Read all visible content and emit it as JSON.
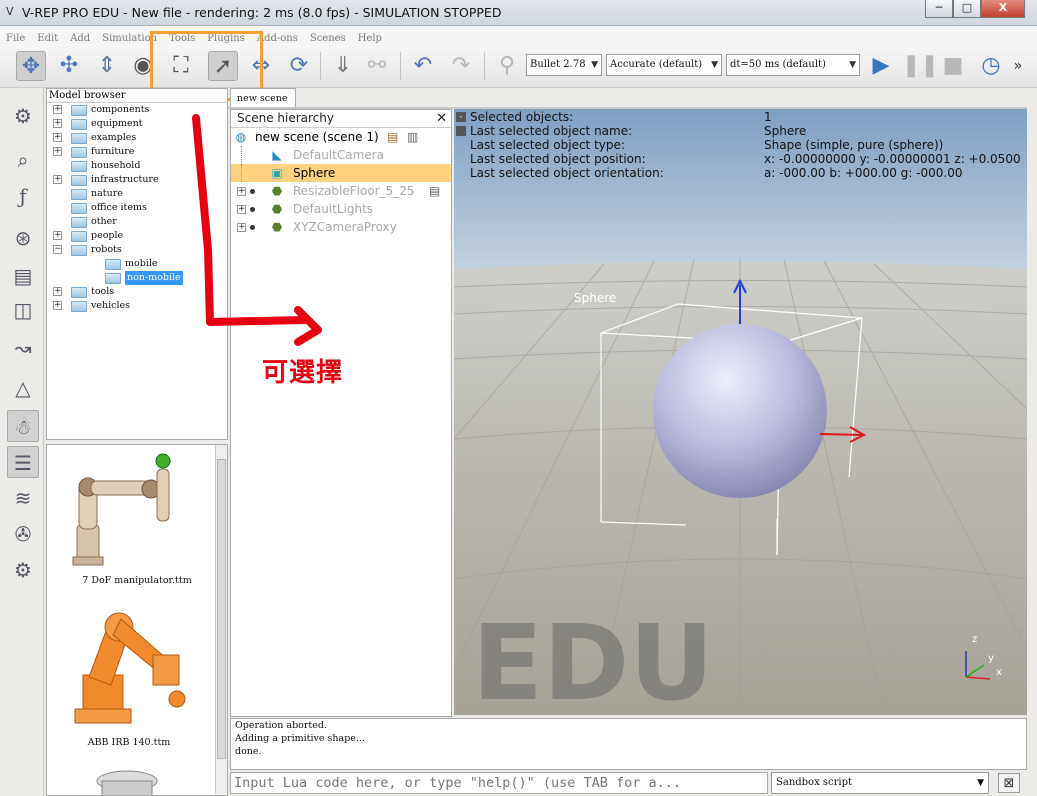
{
  "window": {
    "title": "V-REP PRO EDU - New file - rendering: 2 ms (8.0 fps) - SIMULATION STOPPED",
    "min_glyph": "─",
    "max_glyph": "□",
    "close_glyph": "X"
  },
  "menu": [
    "File",
    "Edit",
    "Add",
    "Simulation",
    "Tools",
    "Plugins",
    "Add-ons",
    "Scenes",
    "Help"
  ],
  "toolbar": {
    "physics_engine": "Bullet 2.78",
    "accuracy": "Accurate (default)",
    "timestep": "dt=50 ms (default)",
    "more_glyph": "»"
  },
  "model_browser": {
    "header": "Model browser",
    "items": [
      {
        "label": "components",
        "expander": "+",
        "indent": 0
      },
      {
        "label": "equipment",
        "expander": "+",
        "indent": 0
      },
      {
        "label": "examples",
        "expander": "+",
        "indent": 0
      },
      {
        "label": "furniture",
        "expander": "+",
        "indent": 0
      },
      {
        "label": "household",
        "expander": "",
        "indent": 0
      },
      {
        "label": "infrastructure",
        "expander": "+",
        "indent": 0
      },
      {
        "label": "nature",
        "expander": "",
        "indent": 0
      },
      {
        "label": "office items",
        "expander": "",
        "indent": 0
      },
      {
        "label": "other",
        "expander": "",
        "indent": 0
      },
      {
        "label": "people",
        "expander": "+",
        "indent": 0
      },
      {
        "label": "robots",
        "expander": "−",
        "indent": 0
      },
      {
        "label": "mobile",
        "expander": "",
        "indent": 1
      },
      {
        "label": "non-mobile",
        "expander": "",
        "indent": 1,
        "selected": true
      },
      {
        "label": "tools",
        "expander": "+",
        "indent": 0
      },
      {
        "label": "vehicles",
        "expander": "+",
        "indent": 0
      }
    ],
    "thumbnails": [
      "7 DoF manipulator.ttm",
      "ABB IRB 140.ttm"
    ]
  },
  "scene_tab": "new scene",
  "hierarchy": {
    "header": "Scene hierarchy",
    "close_glyph": "✕",
    "root": "new scene (scene 1)",
    "items": [
      {
        "name": "DefaultCamera",
        "icon": "camera-icon",
        "dim": true,
        "expander": false
      },
      {
        "name": "Sphere",
        "icon": "shape-icon",
        "dim": false,
        "selected": true,
        "expander": false
      },
      {
        "name": "ResizableFloor_5_25",
        "icon": "dummy-icon",
        "dim": true,
        "expander": true
      },
      {
        "name": "DefaultLights",
        "icon": "dummy-icon",
        "dim": true,
        "expander": true
      },
      {
        "name": "XYZCameraProxy",
        "icon": "dummy-icon",
        "dim": true,
        "expander": true
      }
    ]
  },
  "info": {
    "labels": [
      "Selected objects:",
      "Last selected object name:",
      "Last selected object type:",
      "Last selected object position:",
      "Last selected object orientation:"
    ],
    "values": [
      "1",
      "Sphere",
      "Shape (simple, pure (sphere))",
      "x: -0.00000000    y: -0.00000001    z: +0.0500",
      "a: -000.00    b: +000.00    g: -000.00"
    ]
  },
  "viewport": {
    "object_label": "Sphere",
    "watermark": "EDU",
    "axis_x": "x",
    "axis_y": "y",
    "axis_z": "z"
  },
  "console": {
    "lines": [
      "Operation aborted.",
      "Adding a primitive shape...",
      "done."
    ]
  },
  "lua_input": {
    "placeholder": "Input Lua code here, or type \"help()\" (use TAB for a..."
  },
  "sandbox": "Sandbox script",
  "annotation": {
    "text": "可選擇",
    "color": "#e60012",
    "highlight_color": "#f5a030"
  }
}
